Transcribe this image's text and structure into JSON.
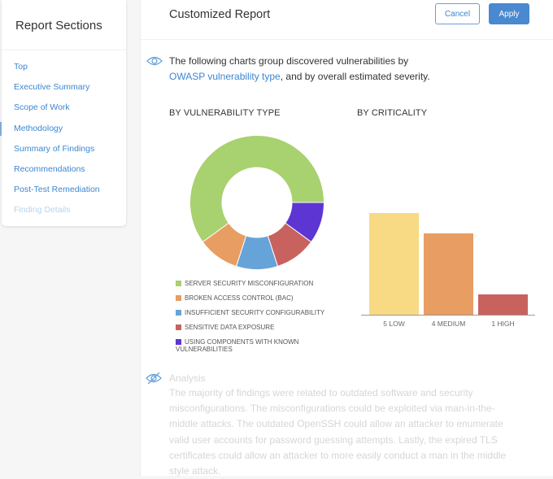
{
  "sidebar": {
    "title": "Report Sections",
    "items": [
      {
        "label": "Top",
        "state": "normal"
      },
      {
        "label": "Executive Summary",
        "state": "normal"
      },
      {
        "label": "Scope of Work",
        "state": "normal"
      },
      {
        "label": "Methodology",
        "state": "active"
      },
      {
        "label": "Summary of Findings",
        "state": "normal"
      },
      {
        "label": "Recommendations",
        "state": "normal"
      },
      {
        "label": "Post-Test Remediation",
        "state": "normal"
      },
      {
        "label": "Finding Details",
        "state": "disabled"
      }
    ]
  },
  "header": {
    "title": "Customized Report",
    "cancel_label": "Cancel",
    "apply_label": "Apply"
  },
  "intro": {
    "icon": "eye-icon",
    "text_before": "The following charts group discovered vulnerabilities by ",
    "link_text": "OWASP vulnerability type",
    "text_after": ", and by overall estimated severity."
  },
  "analysis": {
    "icon": "eye-off-icon",
    "title": "Analysis",
    "text": "The majority of findings were related to outdated software and security misconfigurations. The misconfigurations could be exploited via man-in-the-middle attacks. The outdated OpenSSH could allow an attacker to enumerate valid user accounts for password guessing attempts. Lastly, the expired TLS certificates could allow an attacker to more easily conduct a man in the middle style attack."
  },
  "colors": {
    "accent": "#3d86d1",
    "apply_button": "#4a88cf"
  },
  "chart_data": [
    {
      "type": "pie",
      "variant": "donut",
      "title": "BY VULNERABILITY TYPE",
      "legend_position": "bottom",
      "categories": [
        "SERVER SECURITY MISCONFIGURATION",
        "BROKEN ACCESS CONTROL (BAC)",
        "INSUFFICIENT SECURITY CONFIGURABILITY",
        "SENSITIVE DATA EXPOSURE",
        "USING COMPONENTS WITH KNOWN VULNERABILITIES"
      ],
      "values": [
        6,
        1,
        1,
        1,
        1
      ],
      "percent": [
        60,
        10,
        10,
        10,
        10
      ],
      "colors": [
        "#a8d16f",
        "#e89d63",
        "#66a3d8",
        "#c8625e",
        "#5c35d3"
      ]
    },
    {
      "type": "bar",
      "title": "BY CRITICALITY",
      "categories": [
        "5 LOW",
        "4 MEDIUM",
        "1 HIGH"
      ],
      "values": [
        5,
        4,
        1
      ],
      "colors": [
        "#f8d984",
        "#e89d63",
        "#c8625e"
      ],
      "ylim": [
        0,
        10
      ],
      "grid": false,
      "xlabel": "",
      "ylabel": ""
    }
  ]
}
